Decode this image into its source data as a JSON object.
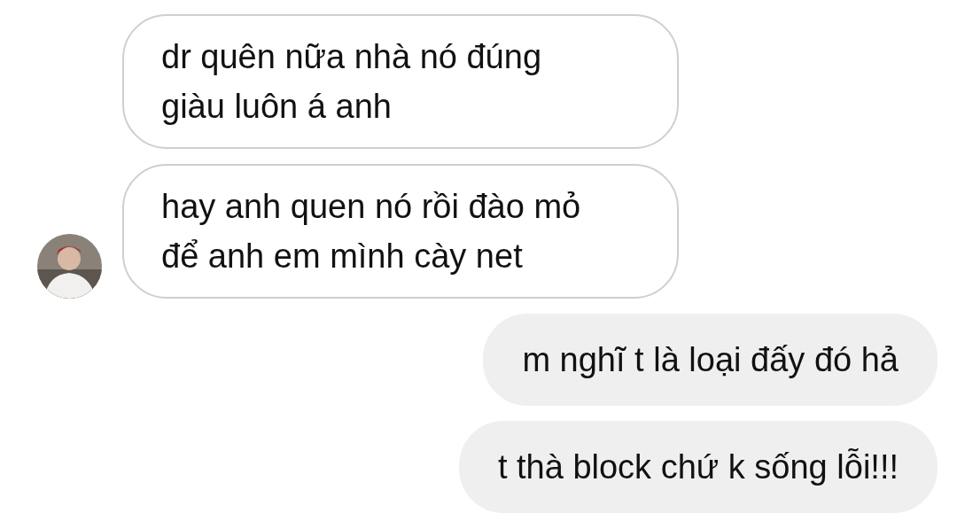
{
  "messages": [
    {
      "kind": "incoming",
      "text": "dr quên nữa nhà nó đúng giàu luôn á anh",
      "show_avatar": false
    },
    {
      "kind": "incoming",
      "text": "hay anh quen nó rồi đào mỏ để anh em mình cày net",
      "show_avatar": true
    },
    {
      "kind": "outgoing",
      "text": "m nghĩ t là loại đấy đó hả",
      "show_avatar": false
    },
    {
      "kind": "outgoing",
      "text": "t thà block chứ k sống lỗi!!!",
      "show_avatar": false
    }
  ]
}
